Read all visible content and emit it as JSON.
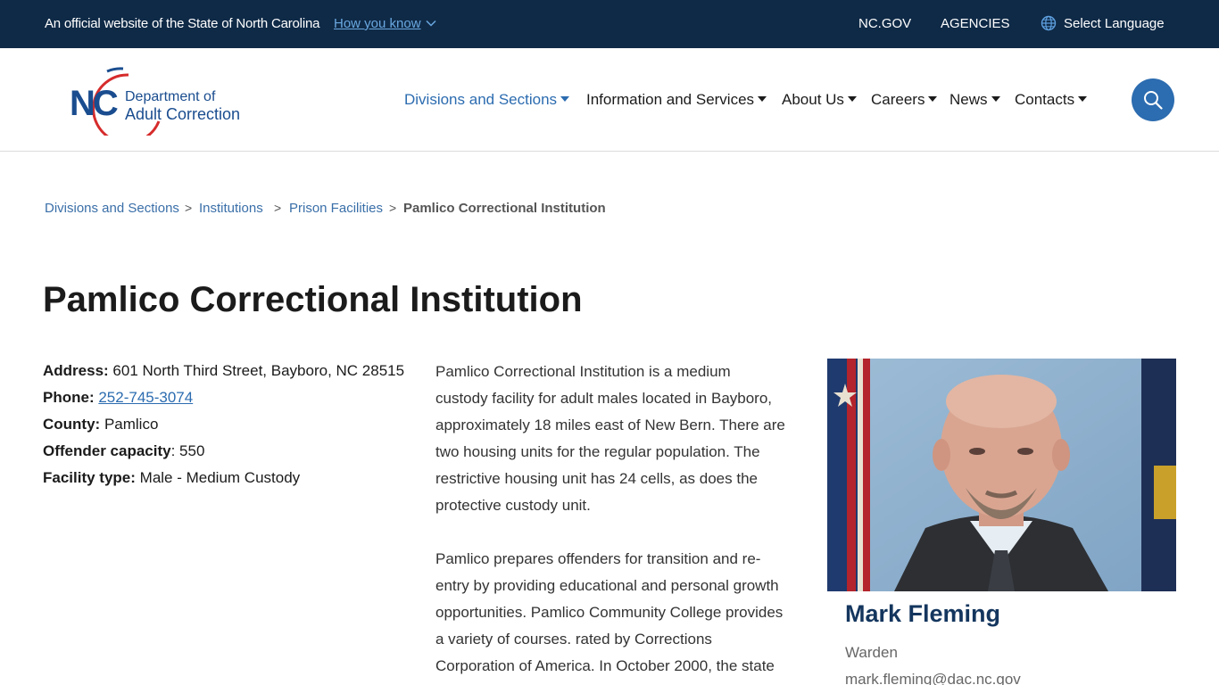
{
  "topbar": {
    "official_text": "An official website of the State of North Carolina",
    "how_you_know": "How you know",
    "links": [
      "NC.GOV",
      "AGENCIES"
    ],
    "language": "Select Language"
  },
  "logo": {
    "nc": "NC",
    "line1": "Department of",
    "line2": "Adult Correction"
  },
  "nav": {
    "items": [
      {
        "label": "Divisions and Sections",
        "active": true
      },
      {
        "label": "Information and Services",
        "active": false
      },
      {
        "label": "About Us",
        "active": false
      },
      {
        "label": "Careers",
        "active": false
      },
      {
        "label": "News",
        "active": false
      },
      {
        "label": "Contacts",
        "active": false
      }
    ],
    "search_icon": "search-icon"
  },
  "breadcrumb": {
    "items": [
      "Divisions and Sections",
      "Institutions",
      "Prison Facilities"
    ],
    "current": "Pamlico Correctional Institution",
    "separator": ">"
  },
  "page": {
    "title": "Pamlico Correctional Institution"
  },
  "facility": {
    "address_label": "Address:",
    "address": "601 North Third Street, Bayboro, NC 28515",
    "phone_label": "Phone:",
    "phone": "252-745-3074",
    "county_label": "County:",
    "county": "Pamlico",
    "capacity_label": "Offender capacity",
    "capacity": ": 550",
    "type_label": "Facility type:",
    "type": "Male - Medium Custody"
  },
  "description": {
    "lines_p1": [
      "Pamlico Correctional Institution is a medium",
      "custody facility for adult males located in Bayboro,",
      "approximately 18 miles east of New Bern. There are",
      "two housing units for the regular population. The",
      "restrictive housing unit has 24 cells, as does the",
      "protective custody unit."
    ],
    "lines_p2": [
      "Pamlico prepares offenders for transition and re-",
      "entry by providing educational and personal growth",
      "opportunities. Pamlico Community College provides",
      "a variety of courses. rated by Corrections",
      "Corporation of America. In October 2000, the state"
    ]
  },
  "warden": {
    "name": "Mark Fleming",
    "title": "Warden",
    "email": "mark.fleming@dac.nc.gov"
  },
  "colors": {
    "topbar": "#0f2a47",
    "accent": "#2c6cb0",
    "heading": "#14365e"
  }
}
